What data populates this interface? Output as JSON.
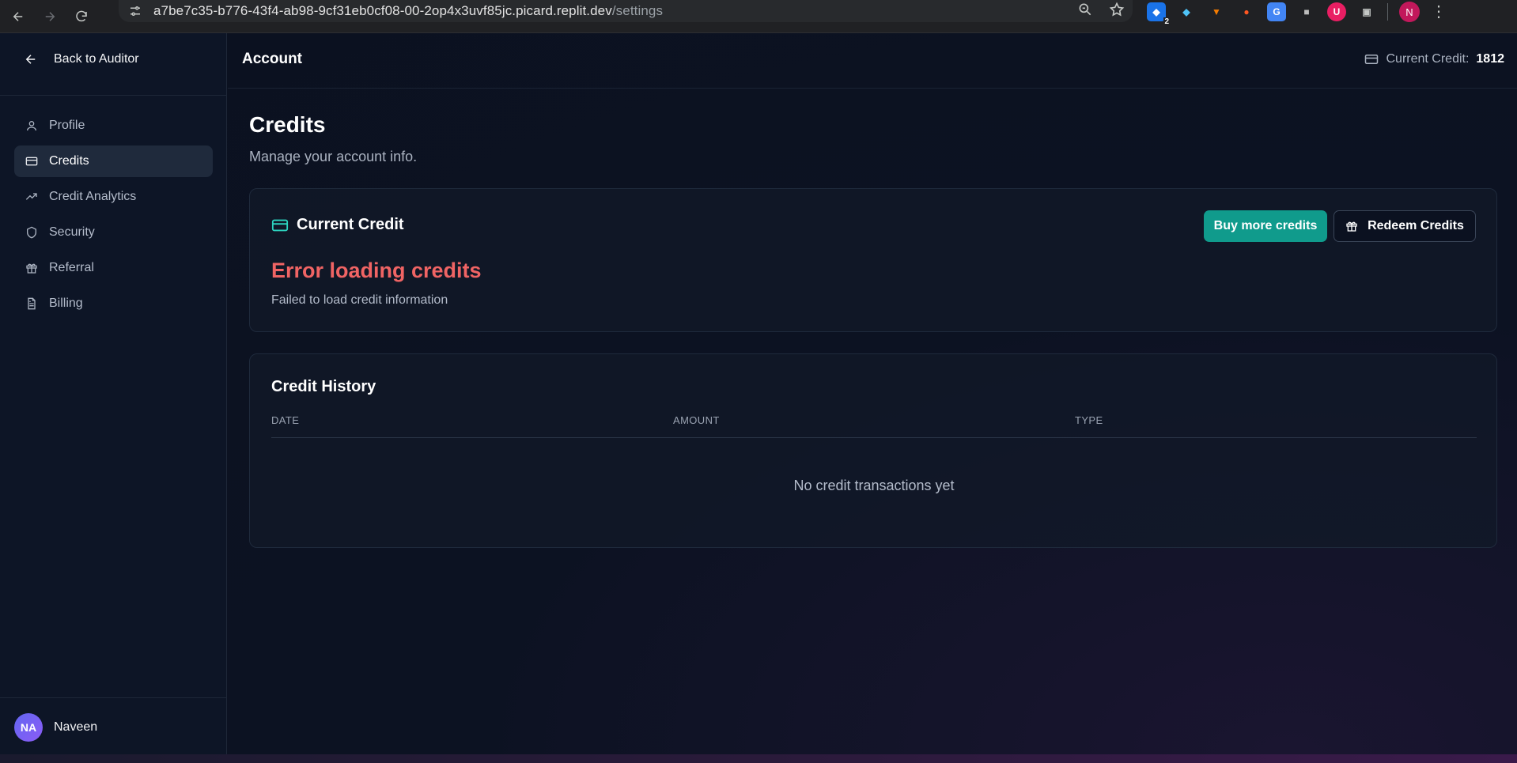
{
  "browser": {
    "url_host": "a7be7c35-b776-43f4-ab98-9cf31eb0cf08-00-2op4x3uvf85jc.picard.replit.dev",
    "url_path": "/settings",
    "extension_badge": "2",
    "profile_initial": "N"
  },
  "sidebar": {
    "back_label": "Back to Auditor",
    "items": [
      {
        "label": "Profile",
        "icon": "user-icon"
      },
      {
        "label": "Credits",
        "icon": "credit-card-icon",
        "active": true
      },
      {
        "label": "Credit Analytics",
        "icon": "trending-up-icon"
      },
      {
        "label": "Security",
        "icon": "shield-icon"
      },
      {
        "label": "Referral",
        "icon": "gift-icon"
      },
      {
        "label": "Billing",
        "icon": "file-text-icon"
      }
    ],
    "user": {
      "initials": "NA",
      "name": "Naveen"
    }
  },
  "topbar": {
    "title": "Account",
    "credit_label": "Current Credit:",
    "credit_value": "1812"
  },
  "page": {
    "title": "Credits",
    "subtitle": "Manage your account info."
  },
  "current_credit_card": {
    "title": "Current Credit",
    "error_title": "Error loading credits",
    "error_message": "Failed to load credit information",
    "buy_label": "Buy more credits",
    "redeem_label": "Redeem Credits"
  },
  "history_card": {
    "title": "Credit History",
    "columns": [
      "DATE",
      "AMOUNT",
      "TYPE"
    ],
    "empty_message": "No credit transactions yet"
  },
  "colors": {
    "accent": "#109b8c",
    "error": "#f06464",
    "background": "#0b1120"
  }
}
